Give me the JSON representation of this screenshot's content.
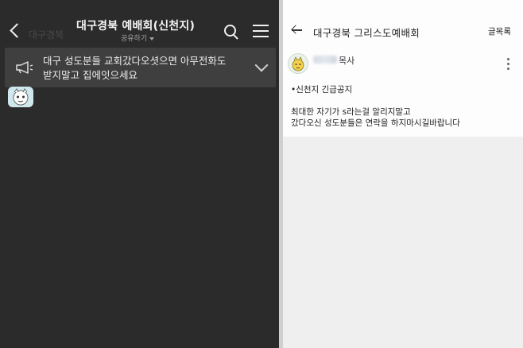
{
  "left_panel": {
    "ghost_text": "대구경북",
    "room_title": "대구경북 예배회(신천지)",
    "room_subtitle": "공유하기",
    "notice": {
      "line1": "대구 성도분들 교회갔다오셧으면 아무전화도",
      "line2": "받지말고 집에잇으세요"
    }
  },
  "right_panel": {
    "title": "대구경북 그리스도예배회",
    "list_label": "글목록",
    "post": {
      "author": "목사",
      "tag": "•신천지 긴급공지",
      "body_line1": "최대한 자기가 s라는걸 알리지말고",
      "body_line2": "갔다오신 성도분들은 연락을 하지마시길바랍니다"
    }
  },
  "icons": [
    "back-icon",
    "search-icon",
    "menu-icon",
    "megaphone-icon",
    "chevron-down-icon",
    "back-arrow-icon",
    "more-vertical-icon"
  ],
  "colors": {
    "dark_bg": "#2b2b2b",
    "notice_bg": "#3f3f3f",
    "light_bg": "#fdfdfd",
    "lower_bg": "#efefef"
  }
}
